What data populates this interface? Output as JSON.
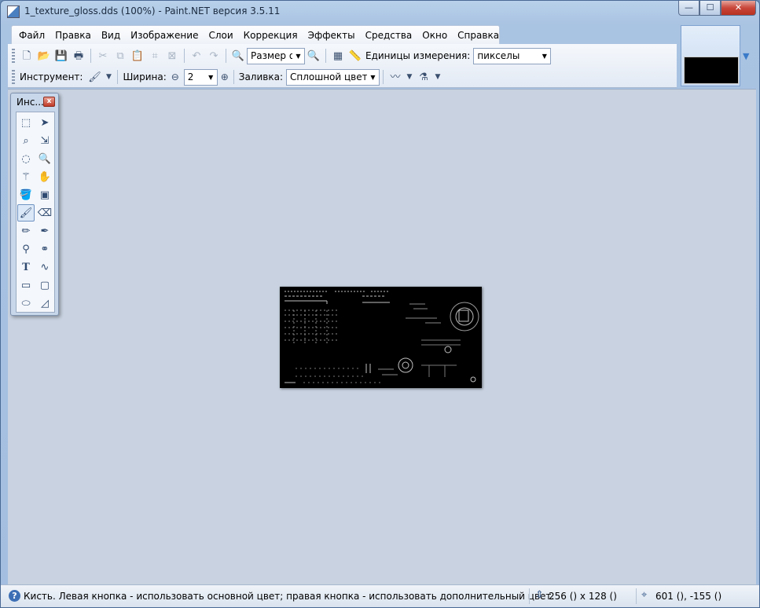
{
  "window": {
    "title": "1_texture_gloss.dds (100%) - Paint.NET версия 3.5.11"
  },
  "window_buttons": {
    "minimize": "—",
    "maximize": "☐",
    "close": "✕"
  },
  "menu": [
    "Файл",
    "Правка",
    "Вид",
    "Изображение",
    "Слои",
    "Коррекция",
    "Эффекты",
    "Средства",
    "Окно",
    "Справка"
  ],
  "toolbar1": {
    "zoom_value": "Размер ок",
    "units_label": "Единицы измерения:",
    "units_value": "пикселы"
  },
  "toolbar2": {
    "tool_label": "Инструмент:",
    "width_label": "Ширина:",
    "width_value": "2",
    "fill_label": "Заливка:",
    "fill_value": "Сплошной цвет"
  },
  "tools_panel": {
    "title": "Инс...",
    "close": "x",
    "tools": [
      "rectangle-select",
      "move-selected-pixels",
      "lasso-select",
      "move-selection",
      "ellipse-select",
      "zoom",
      "magic-wand",
      "pan",
      "paint-bucket",
      "gradient",
      "paintbrush",
      "eraser",
      "pencil",
      "color-picker",
      "clone-stamp",
      "recolor",
      "text",
      "line-curve",
      "rectangle",
      "rounded-rectangle",
      "ellipse",
      "freeform-shape"
    ],
    "active_tool": "paintbrush"
  },
  "status": {
    "info_icon": "?",
    "message": "Кисть. Левая кнопка - использовать основной цвет; правая кнопка - использовать дополнительный цвет.",
    "image_size": "256 () x 128 ()",
    "cursor_position": "601 (), -155 ()"
  }
}
